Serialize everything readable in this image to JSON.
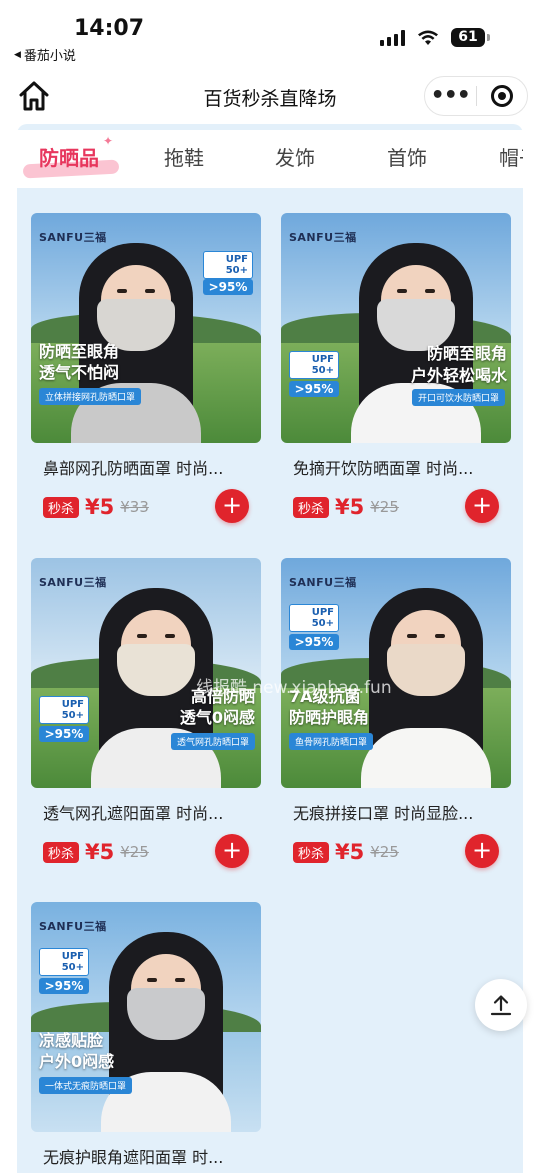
{
  "status_bar": {
    "time": "14:07",
    "back_app": "番茄小说",
    "battery": "61"
  },
  "nav": {
    "title": "百货秒杀直降场",
    "more_icon": "more-dots-icon",
    "close_icon": "mini-program-close-icon"
  },
  "tabs": [
    "防晒品",
    "拖鞋",
    "发饰",
    "首饰",
    "帽子"
  ],
  "products": [
    {
      "name": "鼻部网孔防晒面罩 时尚...",
      "badge": "秒杀",
      "price": "¥5",
      "old_price": "¥33",
      "brand": "SANFU三福",
      "upf": "UPF 50+",
      "upf_note": ">95%",
      "slogan_1": "防晒至眼角",
      "slogan_2": "透气不怕闷",
      "tagline": "立体拼接网孔防晒口罩",
      "mask_color": "#d8d6d2"
    },
    {
      "name": "免摘开饮防晒面罩 时尚...",
      "badge": "秒杀",
      "price": "¥5",
      "old_price": "¥25",
      "brand": "SANFU三福",
      "upf": "UPF 50+",
      "upf_note": ">95%",
      "slogan_1": "防晒至眼角",
      "slogan_2": "户外轻松喝水",
      "tagline": "开口可饮水防晒口罩",
      "mask_color": "#d9d9d9"
    },
    {
      "name": "透气网孔遮阳面罩 时尚...",
      "badge": "秒杀",
      "price": "¥5",
      "old_price": "¥25",
      "brand": "SANFU三福",
      "upf": "UPF 50+",
      "upf_note": ">95%",
      "slogan_1": "高倍防晒",
      "slogan_2": "透气0闷感",
      "tagline": "透气网孔防晒口罩",
      "mask_color": "#e9e2d6"
    },
    {
      "name": "无痕拼接口罩 时尚显脸...",
      "badge": "秒杀",
      "price": "¥5",
      "old_price": "¥25",
      "brand": "SANFU三福",
      "upf": "UPF 50+",
      "upf_note": ">95%",
      "slogan_1": "7A级抗菌",
      "slogan_2": "防晒护眼角",
      "tagline": "鱼骨网孔防晒口罩",
      "mask_color": "#ead9c8"
    },
    {
      "name": "无痕护眼角遮阳面罩 时...",
      "brand": "SANFU三福",
      "upf": "UPF 50+",
      "upf_note": ">95%",
      "slogan_1": "凉感贴脸",
      "slogan_2": "户外0闷感",
      "tagline": "一体式无痕防晒口罩",
      "mask_color": "#c9cacc"
    }
  ],
  "watermark": "线报酷 new.xianbao.fun",
  "colors": {
    "accent": "#e0242c",
    "tab_active": "#e7365d",
    "background": "#e3f0fa"
  }
}
